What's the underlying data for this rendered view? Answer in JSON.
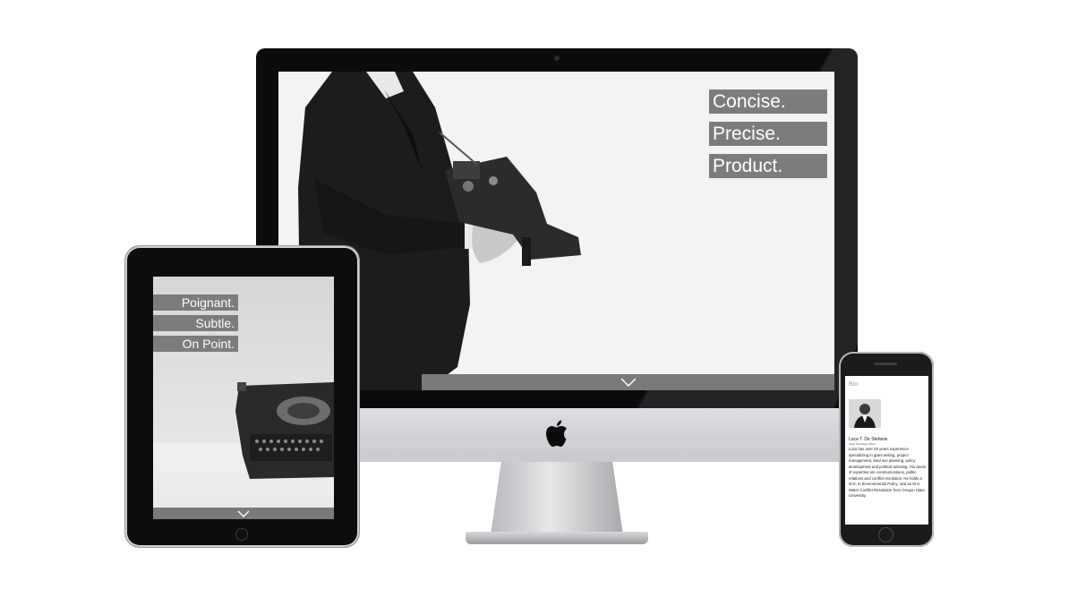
{
  "desktop": {
    "taglines": [
      "Concise.",
      "Precise.",
      "Product."
    ],
    "scroll_icon": "chevron-down-icon",
    "brand_icon": "apple-logo-icon"
  },
  "tablet": {
    "taglines": [
      "Poignant.",
      "Subtle.",
      "On Point."
    ],
    "scroll_icon": "chevron-down-icon"
  },
  "phone": {
    "section_heading": "Bio",
    "name": "Luca T. De Stefanis",
    "role": "Chief Operating Officer",
    "bio": "Luca has over 20 years experience specializing in grant writing, project management, land use planning, policy development and political advising. His areas of expertise are communications, public relations and conflict resolution. He holds a M.S. in Environmental Policy; and an M.S. Water Conflict Resolution from Oregon State University."
  },
  "colors": {
    "tag_background": "#7c7c7c",
    "device_black": "#0b0b0d",
    "silver": "#d6d7d9"
  }
}
